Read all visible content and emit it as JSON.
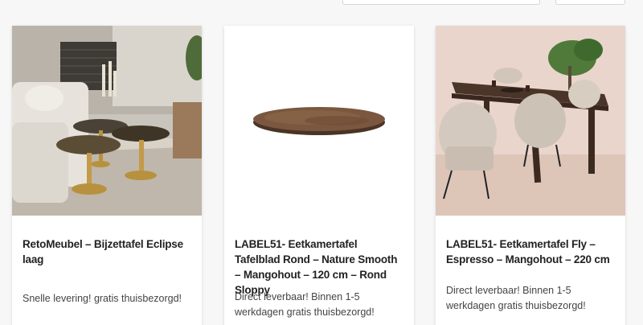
{
  "toolbar": {
    "sort_select": "",
    "per_page_select": ""
  },
  "products": [
    {
      "title": "RetoMeubel – Bijzettafel Eclipse laag",
      "description": "Snelle levering! gratis thuisbezorgd!",
      "image_icon": "side-table-photo"
    },
    {
      "title": "LABEL51- Eetkamertafel Tafelblad Rond – Nature Smooth – Mangohout – 120 cm – Rond Sloppy",
      "description": "Direct leverbaar! Binnen 1-5 werkdagen gratis thuisbezorgd!",
      "image_icon": "round-tabletop-photo"
    },
    {
      "title": "LABEL51- Eetkamertafel Fly – Espresso – Mangohout – 220 cm",
      "description": "Direct leverbaar! Binnen 1-5 werkdagen gratis thuisbezorgd!",
      "image_icon": "dining-table-photo"
    }
  ],
  "colors": {
    "card_bg": "#ffffff",
    "page_bg": "#f7f7f7",
    "title_text": "#222222",
    "body_text": "#444444"
  }
}
